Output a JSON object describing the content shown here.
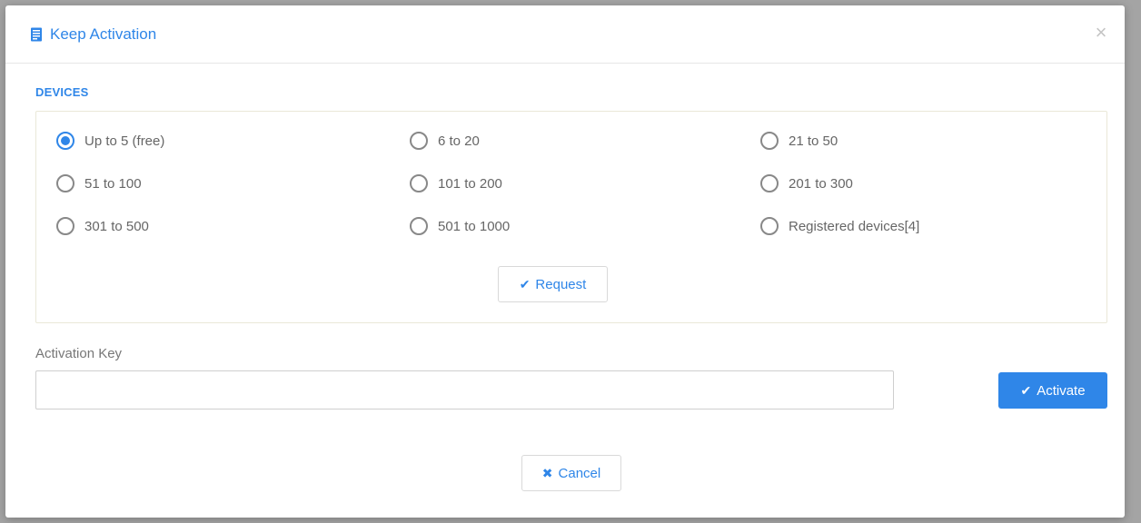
{
  "modal": {
    "title": "Keep Activation",
    "title_icon": "document-icon",
    "close_icon": "close-icon",
    "close_glyph": "×"
  },
  "devices": {
    "section_label": "DEVICES",
    "options": [
      {
        "label": "Up to 5 (free)",
        "checked": true
      },
      {
        "label": "6 to 20",
        "checked": false
      },
      {
        "label": "21 to 50",
        "checked": false
      },
      {
        "label": "51 to 100",
        "checked": false
      },
      {
        "label": "101 to 200",
        "checked": false
      },
      {
        "label": "201 to 300",
        "checked": false
      },
      {
        "label": "301 to 500",
        "checked": false
      },
      {
        "label": "501 to 1000",
        "checked": false
      },
      {
        "label": "Registered devices[4]",
        "checked": false
      }
    ],
    "request_label": "Request",
    "request_icon": "check-icon"
  },
  "activation": {
    "key_label": "Activation Key",
    "key_value": "",
    "key_placeholder": "",
    "activate_label": "Activate",
    "activate_icon": "check-icon"
  },
  "footer": {
    "cancel_label": "Cancel",
    "cancel_icon": "x-icon"
  },
  "colors": {
    "accent": "#2f86e8",
    "radio_unchecked": "#888888",
    "box_border": "#eae8d8"
  }
}
